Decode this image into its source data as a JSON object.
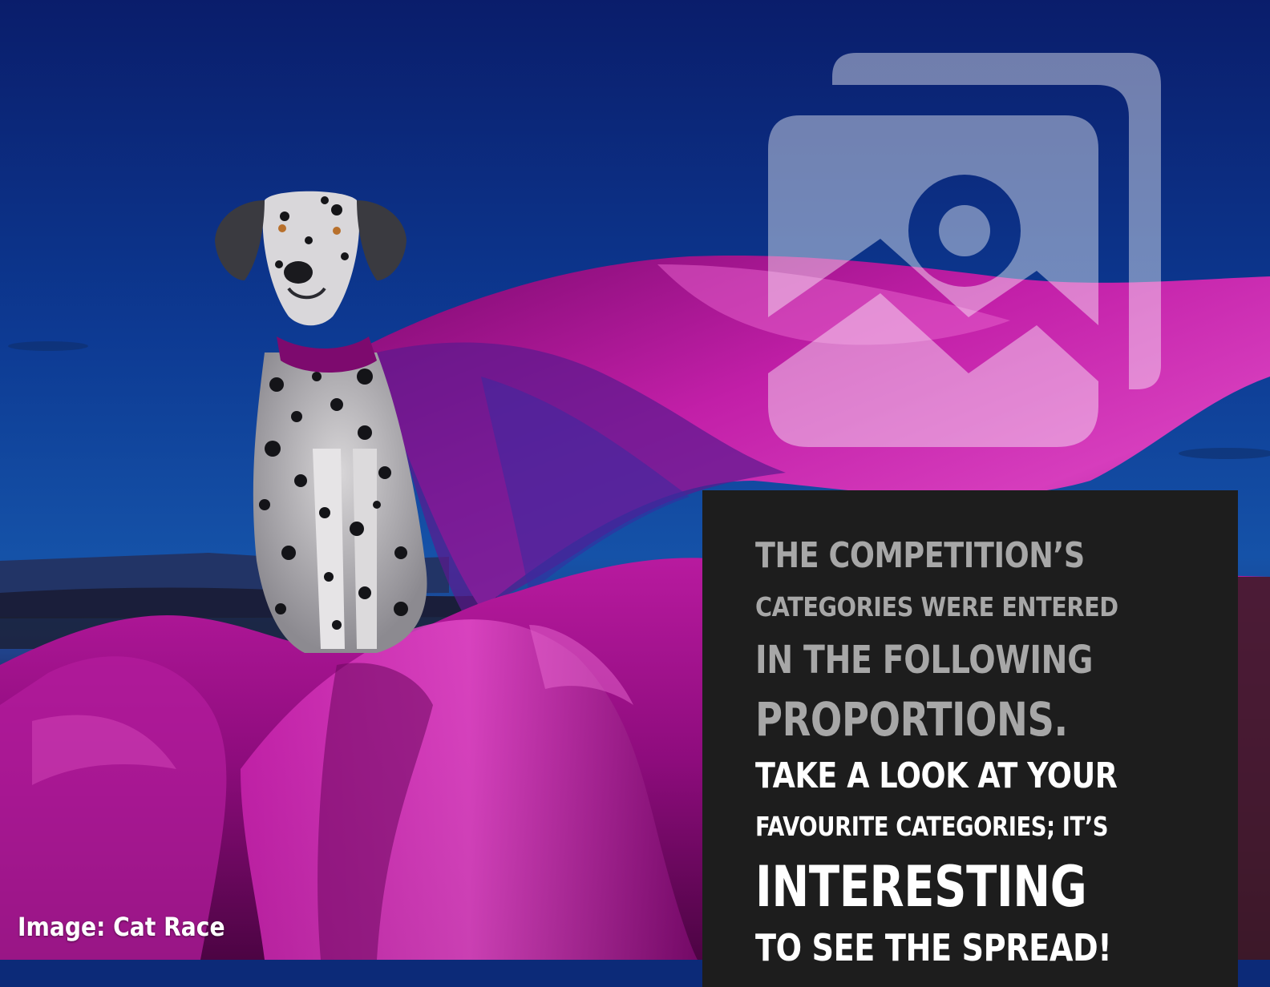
{
  "photo": {
    "subject-icon": "dalmatian-with-cape-photo",
    "colors": {
      "sky_top": "#0b1f6e",
      "sky_mid": "#1246a0",
      "horizon": "#2a3f7a",
      "fabric_light": "#d12cb6",
      "fabric_mid": "#9b0f86",
      "fabric_dark": "#5e0654",
      "panel": "#1d1d1d"
    }
  },
  "watermark": {
    "icon": "image-placeholder-icon",
    "color": "#ffffff"
  },
  "panel": {
    "lines": [
      "THE COMPETITION’S",
      "CATEGORIES WERE ENTERED",
      "IN THE FOLLOWING",
      "PROPORTIONS.",
      "TAKE A LOOK AT YOUR",
      "FAVOURITE CATEGORIES; IT’S",
      "INTERESTING",
      "TO SEE THE SPREAD!"
    ]
  },
  "caption": {
    "text": "Image: Cat Race"
  }
}
